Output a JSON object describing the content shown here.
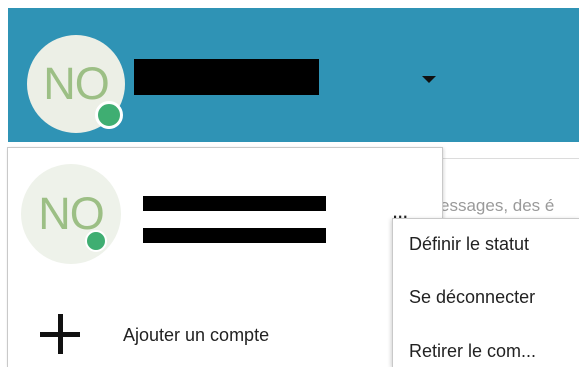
{
  "header": {
    "avatar_initials": "NO",
    "account_name_redacted": "",
    "dropdown_icon": "caret-down-icon"
  },
  "search_hint": "essages, des é",
  "account_panel": {
    "avatar_initials": "NO",
    "more_label": "...",
    "add_account_label": "Ajouter un compte"
  },
  "context_menu": {
    "items": [
      "Définir le statut",
      "Se déconnecter",
      "Retirer le com..."
    ]
  },
  "colors": {
    "header_bg": "#2f93b5",
    "presence": "#3fae72",
    "initials": "#9cbf85"
  }
}
